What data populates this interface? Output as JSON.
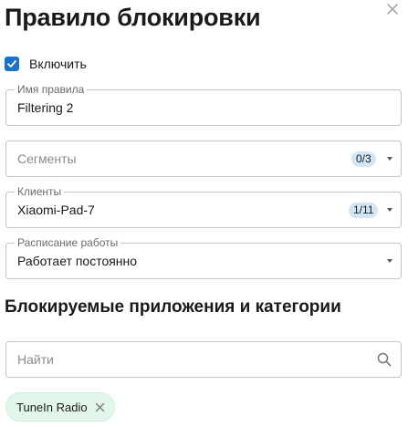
{
  "dialog": {
    "title": "Правило блокировки"
  },
  "enable": {
    "label": "Включить",
    "checked": true
  },
  "rule_name": {
    "legend": "Имя правила",
    "value": "Filtering 2"
  },
  "segments": {
    "placeholder": "Сегменты",
    "count": "0/3"
  },
  "clients": {
    "legend": "Клиенты",
    "value": "Xiaomi-Pad-7",
    "count": "1/11"
  },
  "schedule": {
    "legend": "Расписание работы",
    "value": "Работает постоянно"
  },
  "apps_section": {
    "title": "Блокируемые приложения и категории",
    "search_placeholder": "Найти",
    "chips": [
      {
        "label": "TuneIn Radio"
      }
    ]
  },
  "colors": {
    "accent": "#1a73c8",
    "badge_bg": "#d3e6f5",
    "chip_bg": "#e3f6ec"
  }
}
